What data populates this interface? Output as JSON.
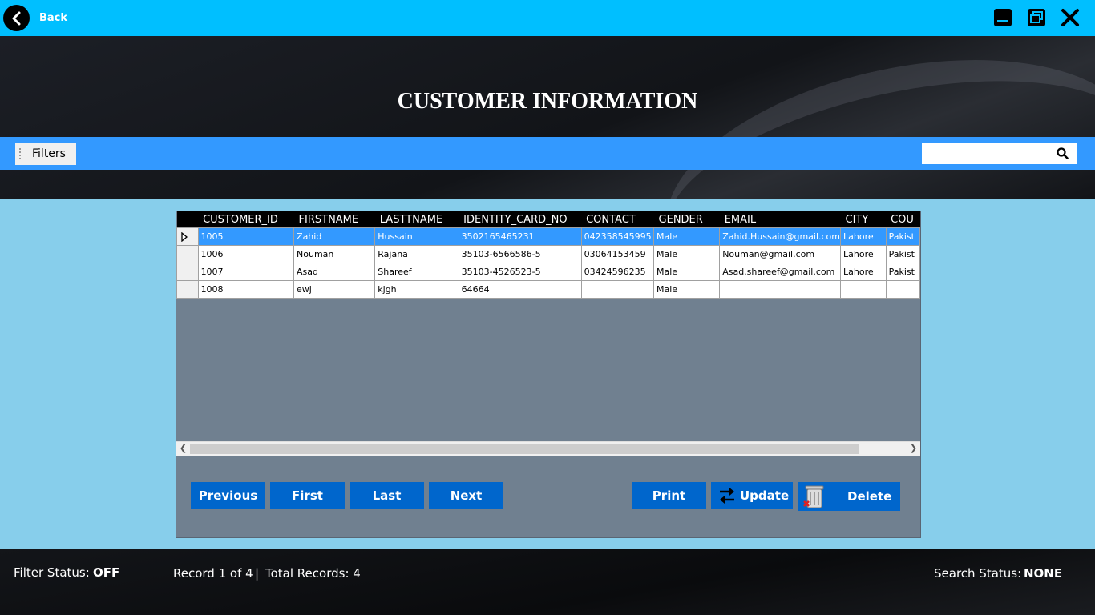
{
  "topbar": {
    "back_label": "Back",
    "accent": "#00bfff"
  },
  "header": {
    "title": "CUSTOMER INFORMATION"
  },
  "filterbar": {
    "filters_label": "Filters",
    "search_value": ""
  },
  "grid": {
    "columns": [
      "CUSTOMER_ID",
      "FIRSTNAME",
      "LASTTNAME",
      "IDENTITY_CARD_NO",
      "CONTACT",
      "GENDER",
      "EMAIL",
      "CITY",
      "COU"
    ],
    "rows": [
      [
        "1005",
        "Zahid",
        "Hussain",
        "3502165465231",
        "042358545995",
        "Male",
        "Zahid.Hussain@gmail.com",
        "Lahore",
        "Pakist"
      ],
      [
        "1006",
        "Nouman",
        "Rajana",
        "35103-6566586-5",
        "03064153459",
        "Male",
        "Nouman@gmail.com",
        "Lahore",
        "Pakist"
      ],
      [
        "1007",
        "Asad",
        "Shareef",
        "35103-4526523-5",
        "03424596235",
        "Male",
        "Asad.shareef@gmail.com",
        "Lahore",
        "Pakist"
      ],
      [
        "1008",
        "ewj",
        "kjgh",
        "64664",
        "",
        "Male",
        "",
        "",
        ""
      ]
    ],
    "selected_row": 0
  },
  "nav": {
    "previous": "Previous",
    "first": "First",
    "last": "Last",
    "next": "Next",
    "print": "Print",
    "update": "Update",
    "delete": "Delete"
  },
  "footer": {
    "filter_status_label": "Filter Status:",
    "filter_status_value": "OFF",
    "record_text": "Record 1 of 4",
    "separator": "|",
    "total_text": "Total Records: 4",
    "search_status_label": "Search Status:",
    "search_status_value": "NONE"
  }
}
